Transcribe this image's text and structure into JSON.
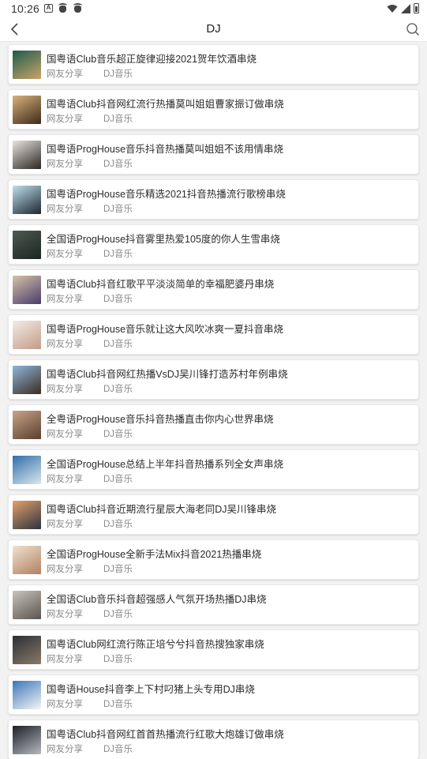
{
  "status_bar": {
    "time": "10:26",
    "left_icons": [
      "a-icon",
      "bug-icon",
      "bug-icon"
    ],
    "right_icons": [
      "wifi-icon",
      "signal-icon",
      "battery-icon"
    ]
  },
  "header": {
    "title": "DJ",
    "back_icon": "chevron-left-icon",
    "search_icon": "search-icon"
  },
  "list": [
    {
      "title": "国粤语Club音乐超正旋律迎接2021贺年饮酒串烧",
      "source": "网友分享",
      "category": "DJ音乐",
      "thumb": [
        "#1e5b4a",
        "#caa36b"
      ]
    },
    {
      "title": "国粤语Club抖音网红流行热播莫叫姐姐曹家振订做串烧",
      "source": "网友分享",
      "category": "DJ音乐",
      "thumb": [
        "#d9b27a",
        "#3b2a1c"
      ]
    },
    {
      "title": "国粤语ProgHouse音乐抖音热播莫叫姐姐不该用情串烧",
      "source": "网友分享",
      "category": "DJ音乐",
      "thumb": [
        "#e8e4df",
        "#2c2622"
      ]
    },
    {
      "title": "国粤语ProgHouse音乐精选2021抖音热播流行歌榜串烧",
      "source": "网友分享",
      "category": "DJ音乐",
      "thumb": [
        "#bfe0ec",
        "#1c2630"
      ]
    },
    {
      "title": "全国语ProgHouse抖音雾里热爱105度的你人生雪串烧",
      "source": "网友分享",
      "category": "DJ音乐",
      "thumb": [
        "#4d5a52",
        "#1d2421"
      ]
    },
    {
      "title": "国粤语Club抖音红歌平平淡淡简单的幸福肥婆丹串烧",
      "source": "网友分享",
      "category": "DJ音乐",
      "thumb": [
        "#d4c3a5",
        "#4a3b6e"
      ]
    },
    {
      "title": "国粤语ProgHouse音乐就让这大风吹冰爽一夏抖音串烧",
      "source": "网友分享",
      "category": "DJ音乐",
      "thumb": [
        "#f1ece6",
        "#c49b86"
      ]
    },
    {
      "title": "国粤语Club抖音网红热播VsDJ吴川锋打造苏村年例串烧",
      "source": "网友分享",
      "category": "DJ音乐",
      "thumb": [
        "#8fb6d9",
        "#3a2c22"
      ]
    },
    {
      "title": "全粤语ProgHouse音乐抖音热播直击你内心世界串烧",
      "source": "网友分享",
      "category": "DJ音乐",
      "thumb": [
        "#c9a488",
        "#5a3e2e"
      ]
    },
    {
      "title": "全国语ProgHouse总结上半年抖音热播系列全女声串烧",
      "source": "网友分享",
      "category": "DJ音乐",
      "thumb": [
        "#2f6fa8",
        "#dbe6f0"
      ]
    },
    {
      "title": "国粤语Club抖音近期流行星辰大海老同DJ吴川锋串烧",
      "source": "网友分享",
      "category": "DJ音乐",
      "thumb": [
        "#e6a06a",
        "#2b3340"
      ]
    },
    {
      "title": "全国语ProgHouse全新手法Mix抖音2021热播串烧",
      "source": "网友分享",
      "category": "DJ音乐",
      "thumb": [
        "#f0e2d0",
        "#b08060"
      ]
    },
    {
      "title": "全国语Club音乐抖音超强感人气氛开场热播DJ串烧",
      "source": "网友分享",
      "category": "DJ音乐",
      "thumb": [
        "#c9c3b8",
        "#5b5450"
      ]
    },
    {
      "title": "国粤语Club网红流行陈正培兮兮抖音热搜独家串烧",
      "source": "网友分享",
      "category": "DJ音乐",
      "thumb": [
        "#2a2f33",
        "#8a7a6a"
      ]
    },
    {
      "title": "国粤语House抖音李上下村叼猪上头专用DJ串烧",
      "source": "网友分享",
      "category": "DJ音乐",
      "thumb": [
        "#3d77b8",
        "#f5f5f5"
      ]
    },
    {
      "title": "国粤语Club抖音网红首首热播流行红歌大炮雄订做串烧",
      "source": "网友分享",
      "category": "DJ音乐",
      "thumb": [
        "#1c1f24",
        "#b4b9c0"
      ]
    }
  ],
  "colors": {
    "background": "#f2f2f2",
    "card": "#ffffff",
    "title_text": "#2b2b2b",
    "meta_text": "#8a8a8a"
  }
}
